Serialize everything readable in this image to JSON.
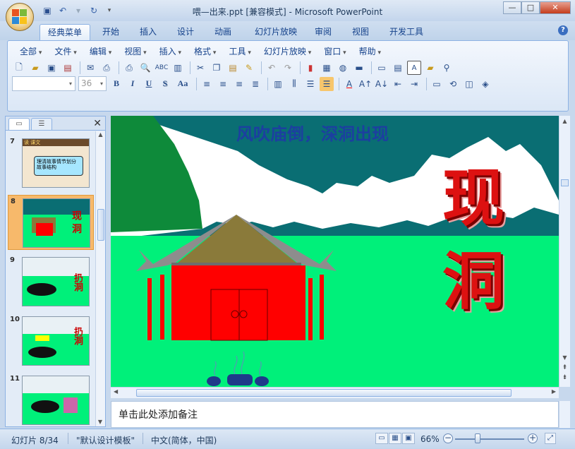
{
  "window": {
    "title": "喂—出来.ppt [兼容模式] - Microsoft PowerPoint",
    "controls": {
      "minimize": "—",
      "maximize": "□",
      "close": "✕"
    }
  },
  "quick_access": [
    "save-icon",
    "undo-icon",
    "redo-icon",
    "customize-icon"
  ],
  "ribbon_tabs": [
    "经典菜单",
    "开始",
    "插入",
    "设计",
    "动画",
    "幻灯片放映",
    "审阅",
    "视图",
    "开发工具"
  ],
  "active_tab": "经典菜单",
  "classic_menus": [
    "全部",
    "文件",
    "编辑",
    "视图",
    "插入",
    "格式",
    "工具",
    "幻灯片放映",
    "窗口",
    "帮助"
  ],
  "font_box": {
    "font": "",
    "size": "36"
  },
  "format_buttons": {
    "bold": "B",
    "italic": "I",
    "underline": "U",
    "shadow": "S",
    "case": "Aa"
  },
  "panel": {
    "tabs": [
      "slides-tab",
      "outline-tab"
    ],
    "slides": [
      {
        "num": "7",
        "caption": "读 课文",
        "text": "理清故事情节划分故事结构"
      },
      {
        "num": "8",
        "caption": "",
        "text": "现 洞",
        "selected": true
      },
      {
        "num": "9",
        "caption": "",
        "text": "扔洞"
      },
      {
        "num": "10",
        "caption": "",
        "text": "扔洞"
      },
      {
        "num": "11",
        "caption": "",
        "text": ""
      }
    ]
  },
  "slide": {
    "title": "风吹庙倒，深洞出现",
    "big_chars": [
      "现",
      "洞"
    ]
  },
  "notes_placeholder": "单击此处添加备注",
  "status": {
    "slide_info": "幻灯片 8/34",
    "template": "\"默认设计模板\"",
    "language": "中文(简体，中国)",
    "zoom": "66%"
  },
  "colors": {
    "ribbon": "#dbe7f6",
    "slide_grass": "#00f07a",
    "slide_sky": "#0a6e73",
    "temple_red": "#ff0000",
    "title_blue": "#1c3fa0"
  }
}
